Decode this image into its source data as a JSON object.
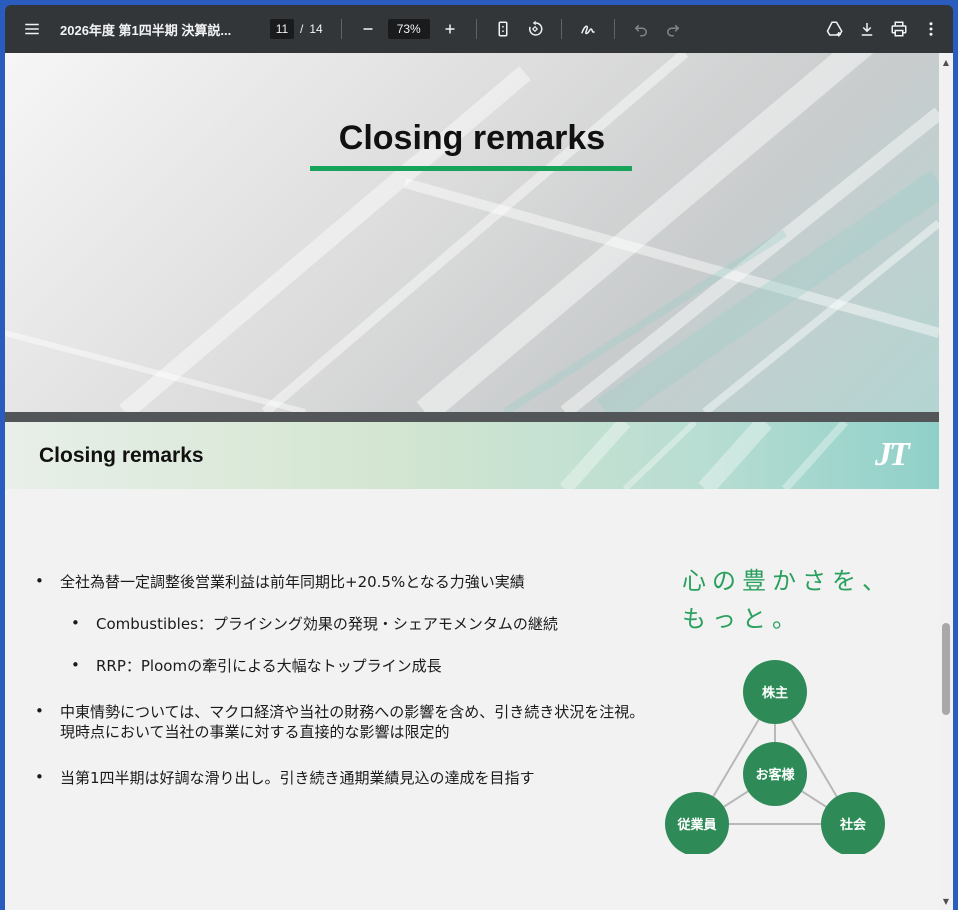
{
  "toolbar": {
    "doc_title": "2026年度 第1四半期 決算説...",
    "current_page": "11",
    "page_separator": "/",
    "total_pages": "14",
    "zoom": "73%"
  },
  "slide1": {
    "title": "Closing remarks"
  },
  "slide2": {
    "title": "Closing remarks",
    "logo_text": "JT",
    "bullets": [
      {
        "level": 1,
        "text": "全社為替一定調整後営業利益は前年同期比+20.5%となる力強い実績"
      },
      {
        "level": 2,
        "text": "Combustibles：プライシング効果の発現・シェアモメンタムの継続"
      },
      {
        "level": 2,
        "text": "RRP：Ploomの牽引による大幅なトップライン成長"
      },
      {
        "level": 1,
        "text": "中東情勢については、マクロ経済や当社の財務への影響を含め、引き続き状況を注視。",
        "text2": "現時点において当社の事業に対する直接的な影響は限定的"
      },
      {
        "level": 1,
        "text": "当第1四半期は好調な滑り出し。引き続き通期業績見込の達成を目指す"
      }
    ],
    "bullet_glyph": "•",
    "slogan_line1": "心の豊かさを、",
    "slogan_line2": "もっと。",
    "diagram": {
      "top": "株主",
      "center": "お客様",
      "left": "従業員",
      "right": "社会",
      "node_color": "#2e8b57"
    }
  },
  "colors": {
    "accent_green": "#17a35a",
    "toolbar_bg": "#323639"
  }
}
